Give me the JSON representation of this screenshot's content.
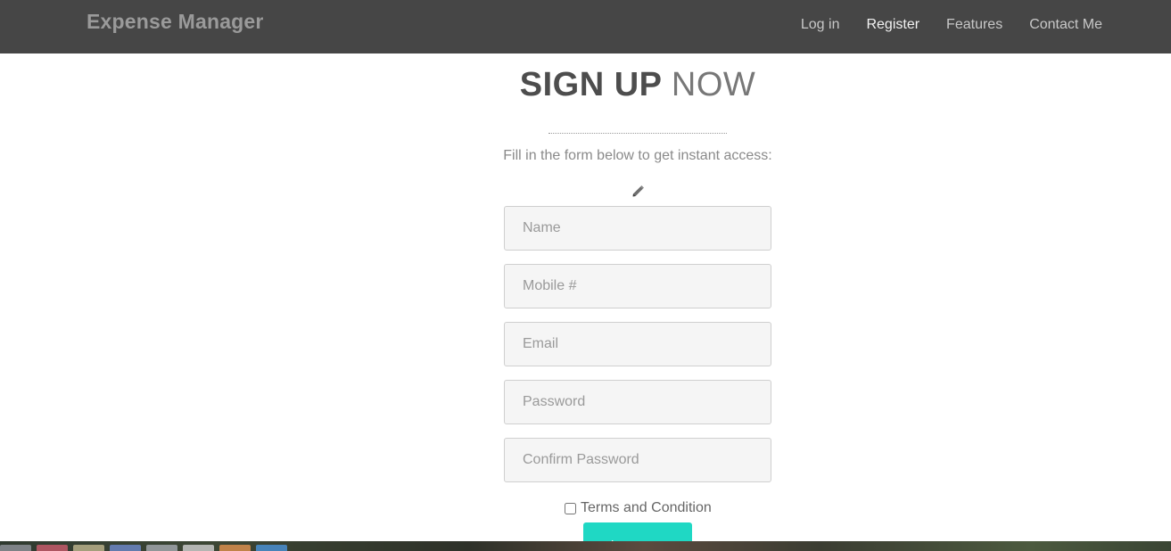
{
  "nav": {
    "brand": "Expense Manager",
    "links": [
      "Log in",
      "Register",
      "Features",
      "Contact Me"
    ]
  },
  "hero": {
    "title_bold": "SIGN UP",
    "title_light": "NOW",
    "subtitle": "Fill in the form below to get instant access:",
    "icon": "pencil-icon"
  },
  "form": {
    "name_placeholder": "Name",
    "mobile_placeholder": "Mobile #",
    "email_placeholder": "Email",
    "password_placeholder": "Password",
    "confirm_password_placeholder": "Confirm Password",
    "terms_label": "Terms and Condition",
    "terms_checked": false,
    "submit_label": "Sign me up!"
  },
  "colors": {
    "navbar": "#464646",
    "accent": "#1fd8c4"
  }
}
